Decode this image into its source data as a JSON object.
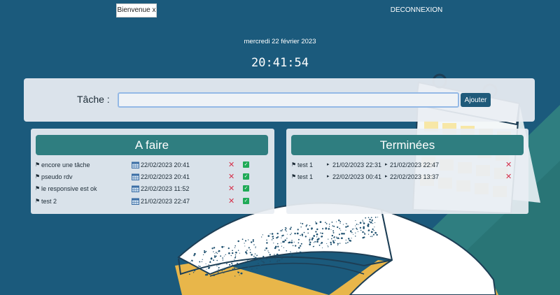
{
  "header": {
    "welcome": "Bienvenue x",
    "logout": "DECONNEXION"
  },
  "date_label": "mercredi 22 février 2023",
  "clock": "20:41:54",
  "form": {
    "label": "Tâche :",
    "input_value": "",
    "button": "Ajouter"
  },
  "todo": {
    "title": "A faire",
    "items": [
      {
        "name": "encore une tâche",
        "when": "22/02/2023 20:41"
      },
      {
        "name": "pseudo rdv",
        "when": "22/02/2023 20:41"
      },
      {
        "name": "le responsive est ok",
        "when": "22/02/2023 11:52"
      },
      {
        "name": "test 2",
        "when": "21/02/2023 22:47"
      }
    ]
  },
  "done": {
    "title": "Terminées",
    "items": [
      {
        "name": "test 1",
        "start": "21/02/2023 22:31",
        "end": "21/02/2023 22:47"
      },
      {
        "name": "test 1",
        "start": "22/02/2023 00:41",
        "end": "22/02/2023 13:37"
      }
    ]
  },
  "icons": {
    "flag": "flag-icon",
    "calendar": "calendar-icon",
    "delete": "cross-icon",
    "complete": "check-icon",
    "arrow": "arrow-right-icon"
  },
  "colors": {
    "background": "#1b5a7c",
    "panel_header": "#2f7e80",
    "button": "#1f5a7a",
    "delete": "#d5304a",
    "complete": "#1faa57"
  }
}
